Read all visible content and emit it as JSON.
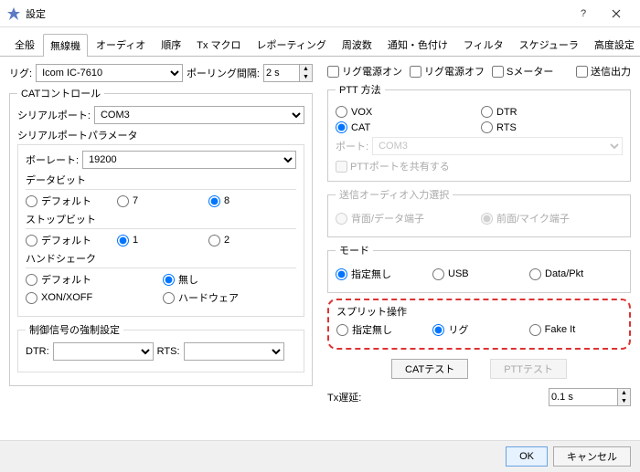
{
  "window": {
    "title": "設定",
    "help": "?",
    "close": "×"
  },
  "tabs": [
    "全般",
    "無線機",
    "オーディオ",
    "順序",
    "Tx マクロ",
    "レポーティング",
    "周波数",
    "通知・色付け",
    "フィルタ",
    "スケジューラ",
    "高度設定"
  ],
  "active_tab": 1,
  "rig": {
    "label": "リグ:",
    "value": "Icom IC-7610"
  },
  "polling": {
    "label": "ポーリング間隔:",
    "value": "2 s"
  },
  "power_on": "リグ電源オン",
  "power_off": "リグ電源オフ",
  "smeter": "Sメーター",
  "tx_output": "送信出力",
  "cat_ctrl": {
    "legend": "CATコントロール",
    "serial_port_label": "シリアルポート:",
    "serial_port_value": "COM3",
    "params_legend": "シリアルポートパラメータ",
    "baud_label": "ボーレート:",
    "baud_value": "19200",
    "databits_label": "データビット",
    "databits": [
      "デフォルト",
      "7",
      "8"
    ],
    "stopbits_label": "ストップビット",
    "stopbits": [
      "デフォルト",
      "1",
      "2"
    ],
    "handshake_label": "ハンドシェーク",
    "handshake": [
      "デフォルト",
      "無し",
      "XON/XOFF",
      "ハードウェア"
    ],
    "force_label": "制御信号の強制設定",
    "dtr_label": "DTR:",
    "rts_label": "RTS:"
  },
  "ptt": {
    "legend": "PTT 方法",
    "opts": [
      "VOX",
      "DTR",
      "CAT",
      "RTS"
    ],
    "port_label": "ポート:",
    "port_value": "COM3",
    "share": "PTTポートを共有する"
  },
  "txaudio": {
    "legend": "送信オーディオ入力選択",
    "opts": [
      "背面/データ端子",
      "前面/マイク端子"
    ]
  },
  "mode": {
    "legend": "モード",
    "opts": [
      "指定無し",
      "USB",
      "Data/Pkt"
    ]
  },
  "split": {
    "legend": "スプリット操作",
    "opts": [
      "指定無し",
      "リグ",
      "Fake It"
    ]
  },
  "cat_test": "CATテスト",
  "ptt_test": "PTTテスト",
  "tx_delay": {
    "label": "Tx遅延:",
    "value": "0.1 s"
  },
  "footer": {
    "ok": "OK",
    "cancel": "キャンセル"
  }
}
